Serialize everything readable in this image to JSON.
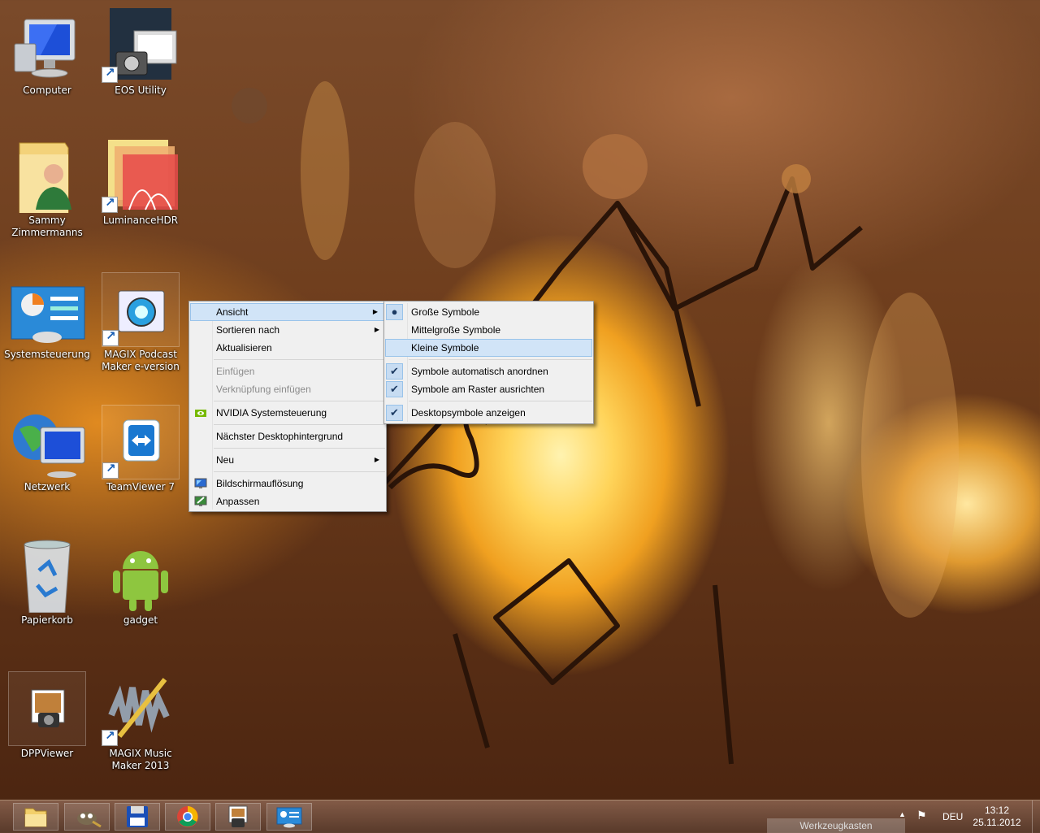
{
  "desktop": {
    "icons": [
      {
        "label": "Computer"
      },
      {
        "label": "EOS Utility"
      },
      {
        "label": "Sammy Zimmermanns"
      },
      {
        "label": "LuminanceHDR"
      },
      {
        "label": "Systemsteuerung"
      },
      {
        "label": "MAGIX Podcast Maker e-version"
      },
      {
        "label": "Netzwerk"
      },
      {
        "label": "TeamViewer 7"
      },
      {
        "label": "Papierkorb"
      },
      {
        "label": "gadget"
      },
      {
        "label": "DPPViewer"
      },
      {
        "label": "MAGIX Music Maker 2013"
      }
    ]
  },
  "context_menu": {
    "items": [
      {
        "label": "Ansicht"
      },
      {
        "label": "Sortieren nach"
      },
      {
        "label": "Aktualisieren"
      },
      {
        "label": "Einfügen"
      },
      {
        "label": "Verknüpfung einfügen"
      },
      {
        "label": "NVIDIA Systemsteuerung"
      },
      {
        "label": "Nächster Desktophintergrund"
      },
      {
        "label": "Neu"
      },
      {
        "label": "Bildschirmauflösung"
      },
      {
        "label": "Anpassen"
      }
    ]
  },
  "submenu": {
    "items": [
      {
        "label": "Große Symbole",
        "selected": true
      },
      {
        "label": "Mittelgroße Symbole"
      },
      {
        "label": "Kleine Symbole",
        "highlighted": true
      },
      {
        "label": "Symbole automatisch anordnen",
        "checked": true
      },
      {
        "label": "Symbole am Raster ausrichten",
        "checked": true
      },
      {
        "label": "Desktopsymbole anzeigen",
        "checked": true
      }
    ]
  },
  "taskbar": {
    "toolbar_label": "Werkzeugkasten",
    "language": "DEU",
    "time": "13:12",
    "date": "25.11.2012",
    "pinned": [
      "file-explorer-icon",
      "gimp-icon",
      "save-icon",
      "chrome-icon",
      "dpp-icon",
      "control-panel-icon"
    ]
  },
  "colors": {
    "menu_bg": "#f0f0f0",
    "menu_highlight": "#d1e4f7",
    "menu_highlight_border": "#99c3ea"
  }
}
